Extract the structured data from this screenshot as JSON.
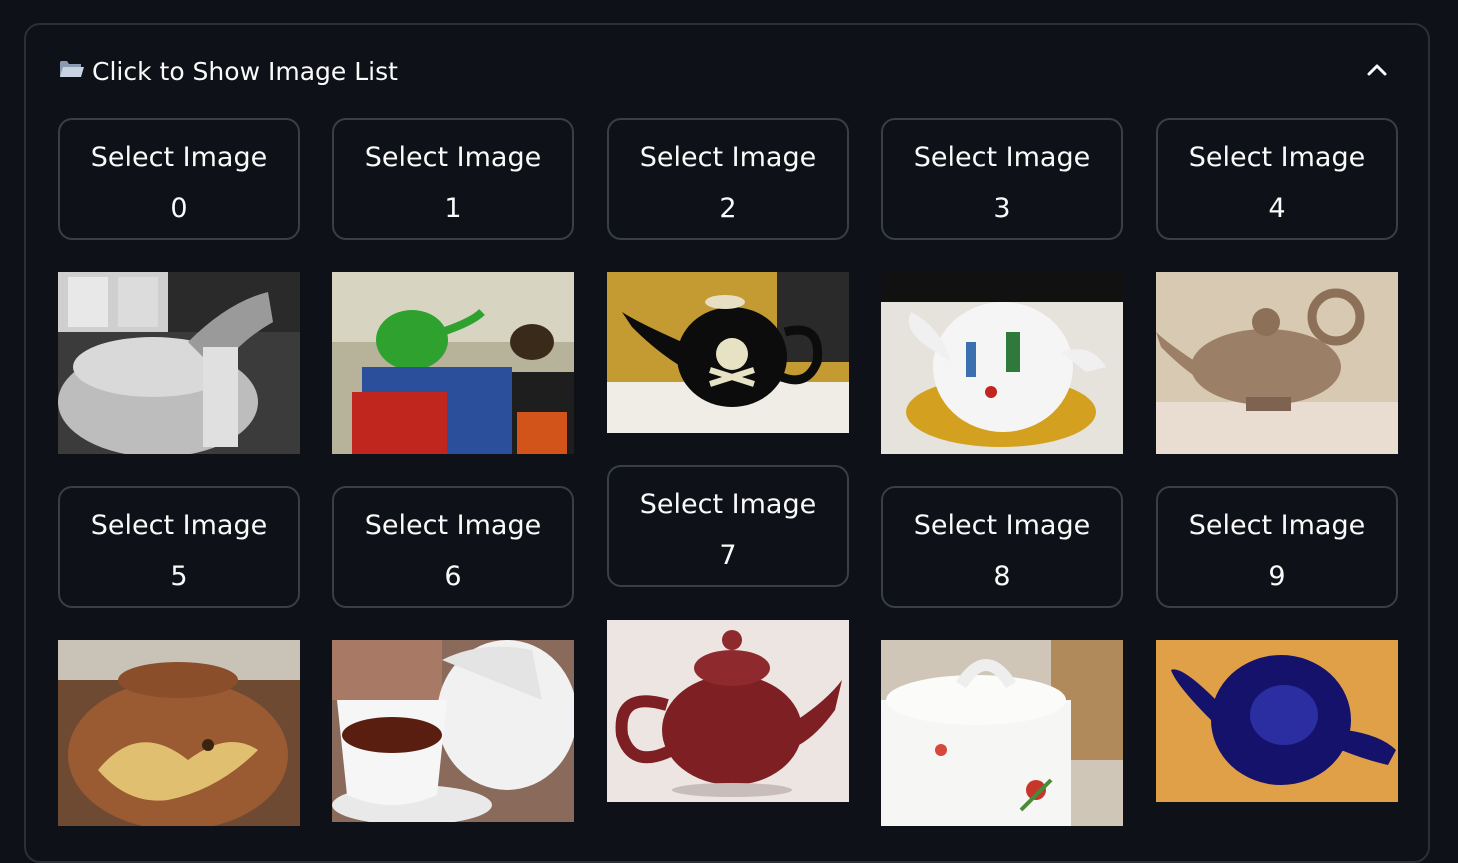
{
  "expander": {
    "icon": "open-folder-icon",
    "title": "Click to Show Image List",
    "toggle_icon": "chevron-up-icon"
  },
  "buttons": [
    {
      "line1": "Select Image",
      "line2": "0"
    },
    {
      "line1": "Select Image",
      "line2": "1"
    },
    {
      "line1": "Select Image",
      "line2": "2"
    },
    {
      "line1": "Select Image",
      "line2": "3"
    },
    {
      "line1": "Select Image",
      "line2": "4"
    },
    {
      "line1": "Select Image",
      "line2": "5"
    },
    {
      "line1": "Select Image",
      "line2": "6"
    },
    {
      "line1": "Select Image",
      "line2": "7"
    },
    {
      "line1": "Select Image",
      "line2": "8"
    },
    {
      "line1": "Select Image",
      "line2": "9"
    }
  ],
  "images": [
    {
      "subject": "grayscale white teapot"
    },
    {
      "subject": "green glass teapot on tin box"
    },
    {
      "subject": "black skull and crossbones teapot"
    },
    {
      "subject": "alice in wonderland teapot cake"
    },
    {
      "subject": "clay dotted teapot"
    },
    {
      "subject": "brown yixing teapot with phoenix"
    },
    {
      "subject": "white elephant teapot with tea cup"
    },
    {
      "subject": "maroon glazed teapot"
    },
    {
      "subject": "white floral porcelain teapot"
    },
    {
      "subject": "dark blue teapot top view"
    }
  ],
  "colors": {
    "background": "#0e1117",
    "border": "#3a3e48",
    "text": "#fafafa"
  }
}
